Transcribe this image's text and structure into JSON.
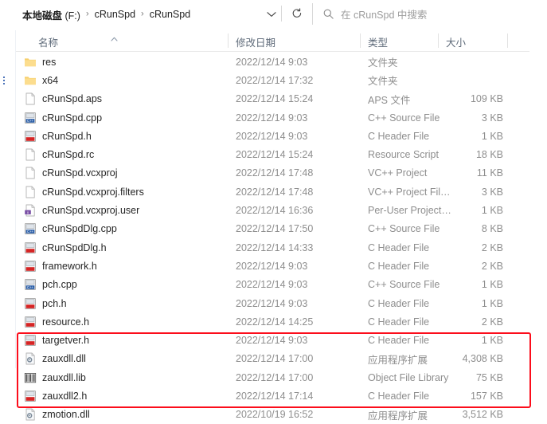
{
  "addressbar": {
    "crumbs": [
      {
        "label": "本地磁盘",
        "suffix": " (F:)"
      },
      {
        "label": "cRunSpd",
        "suffix": ""
      },
      {
        "label": "cRunSpd",
        "suffix": ""
      }
    ],
    "separator": "›",
    "dropdown_icon": "chevron-down-icon",
    "refresh_icon": "refresh-icon",
    "search_icon": "search-icon",
    "search_placeholder": "在 cRunSpd 中搜索"
  },
  "columns": [
    {
      "key": "name",
      "label": "名称",
      "sorted": "asc"
    },
    {
      "key": "date",
      "label": "修改日期",
      "sorted": ""
    },
    {
      "key": "type",
      "label": "类型",
      "sorted": ""
    },
    {
      "key": "size",
      "label": "大小",
      "sorted": ""
    }
  ],
  "files": [
    {
      "icon": "folder-icon",
      "name": "res",
      "date": "2022/12/14 9:03",
      "type": "文件夹",
      "size": ""
    },
    {
      "icon": "folder-icon",
      "name": "x64",
      "date": "2022/12/14 17:32",
      "type": "文件夹",
      "size": ""
    },
    {
      "icon": "blank-file-icon",
      "name": "cRunSpd.aps",
      "date": "2022/12/14 15:24",
      "type": "APS 文件",
      "size": "109 KB"
    },
    {
      "icon": "cpp-file-icon",
      "name": "cRunSpd.cpp",
      "date": "2022/12/14 9:03",
      "type": "C++ Source File",
      "size": "3 KB"
    },
    {
      "icon": "header-file-icon",
      "name": "cRunSpd.h",
      "date": "2022/12/14 9:03",
      "type": "C Header File",
      "size": "1 KB"
    },
    {
      "icon": "blank-file-icon",
      "name": "cRunSpd.rc",
      "date": "2022/12/14 15:24",
      "type": "Resource Script",
      "size": "18 KB"
    },
    {
      "icon": "blank-file-icon",
      "name": "cRunSpd.vcxproj",
      "date": "2022/12/14 17:48",
      "type": "VC++ Project",
      "size": "11 KB"
    },
    {
      "icon": "blank-file-icon",
      "name": "cRunSpd.vcxproj.filters",
      "date": "2022/12/14 17:48",
      "type": "VC++ Project Fil…",
      "size": "3 KB"
    },
    {
      "icon": "xml-file-icon",
      "name": "cRunSpd.vcxproj.user",
      "date": "2022/12/14 16:36",
      "type": "Per-User Project…",
      "size": "1 KB"
    },
    {
      "icon": "cpp-file-icon",
      "name": "cRunSpdDlg.cpp",
      "date": "2022/12/14 17:50",
      "type": "C++ Source File",
      "size": "8 KB"
    },
    {
      "icon": "header-file-icon",
      "name": "cRunSpdDlg.h",
      "date": "2022/12/14 14:33",
      "type": "C Header File",
      "size": "2 KB"
    },
    {
      "icon": "header-file-icon",
      "name": "framework.h",
      "date": "2022/12/14 9:03",
      "type": "C Header File",
      "size": "2 KB"
    },
    {
      "icon": "cpp-file-icon",
      "name": "pch.cpp",
      "date": "2022/12/14 9:03",
      "type": "C++ Source File",
      "size": "1 KB"
    },
    {
      "icon": "header-file-icon",
      "name": "pch.h",
      "date": "2022/12/14 9:03",
      "type": "C Header File",
      "size": "1 KB"
    },
    {
      "icon": "header-file-icon",
      "name": "resource.h",
      "date": "2022/12/14 14:25",
      "type": "C Header File",
      "size": "2 KB"
    },
    {
      "icon": "header-file-icon",
      "name": "targetver.h",
      "date": "2022/12/14 9:03",
      "type": "C Header File",
      "size": "1 KB"
    },
    {
      "icon": "dll-file-icon",
      "name": "zauxdll.dll",
      "date": "2022/12/14 17:00",
      "type": "应用程序扩展",
      "size": "4,308 KB"
    },
    {
      "icon": "lib-file-icon",
      "name": "zauxdll.lib",
      "date": "2022/12/14 17:00",
      "type": "Object File Library",
      "size": "75 KB"
    },
    {
      "icon": "header-file-icon",
      "name": "zauxdll2.h",
      "date": "2022/12/14 17:14",
      "type": "C Header File",
      "size": "157 KB"
    },
    {
      "icon": "dll-file-icon",
      "name": "zmotion.dll",
      "date": "2022/10/19 16:52",
      "type": "应用程序扩展",
      "size": "3,512 KB"
    }
  ],
  "annotation": {
    "name": "red-highlight-box",
    "color": "#fc0d1b",
    "covers_rows": [
      "zauxdll.dll",
      "zauxdll.lib",
      "zauxdll2.h",
      "zmotion.dll"
    ]
  },
  "colors": {
    "folder": "#fbd379",
    "cpp_accent": "#2c5fa8",
    "header_accent": "#d62424",
    "text_primary": "#262626",
    "text_secondary": "#8e8e8e",
    "header_label": "#5f6b7a",
    "annotation_red": "#fc0d1b"
  }
}
